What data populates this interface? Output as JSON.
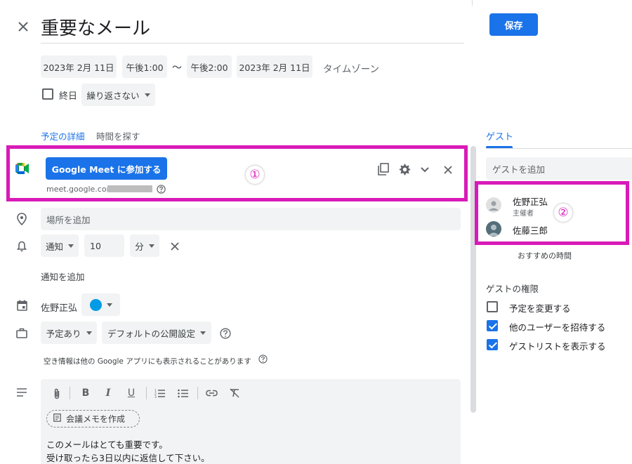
{
  "header": {
    "title": "重要なメール",
    "save_label": "保存"
  },
  "datetime": {
    "start_date": "2023年 2月 11日",
    "start_time": "午後1:00",
    "separator": "〜",
    "end_time": "午後2:00",
    "end_date": "2023年 2月 11日",
    "timezone": "タイムゾーン",
    "all_day_label": "終日",
    "all_day_checked": false,
    "repeat_value": "繰り返さない"
  },
  "tabs": {
    "details": "予定の詳細",
    "find_time": "時間を探す",
    "guests": "ゲスト"
  },
  "meet": {
    "join_label": "Google Meet に参加する",
    "link": "meet.google.com/"
  },
  "annotations": {
    "one": "①",
    "two": "②"
  },
  "location": {
    "placeholder": "場所を追加"
  },
  "notification": {
    "type": "通知",
    "amount": "10",
    "unit": "分",
    "add_label": "通知を追加"
  },
  "calendar": {
    "owner": "佐野正弘",
    "color": "#039be5"
  },
  "visibility": {
    "busy": "予定あり",
    "privacy": "デフォルトの公開設定",
    "note": "空き情報は他の Google アプリにも表示されることがあります"
  },
  "description": {
    "meeting_notes_label": "会議メモを作成",
    "line1": "このメールはとても重要です。",
    "line2": "受け取ったら3日以内に返信して下さい。"
  },
  "guests": {
    "add_placeholder": "ゲストを追加",
    "list": [
      {
        "name": "佐野正弘",
        "role": "主催者"
      },
      {
        "name": "佐藤三郎",
        "role": ""
      }
    ],
    "suggested_times": "おすすめの時間",
    "permissions_title": "ゲストの権限",
    "permissions": [
      {
        "label": "予定を変更する",
        "checked": false
      },
      {
        "label": "他のユーザーを招待する",
        "checked": true
      },
      {
        "label": "ゲストリストを表示する",
        "checked": true
      }
    ]
  },
  "colors": {
    "accent": "#1a73e8",
    "highlight": "#d81bb8"
  }
}
